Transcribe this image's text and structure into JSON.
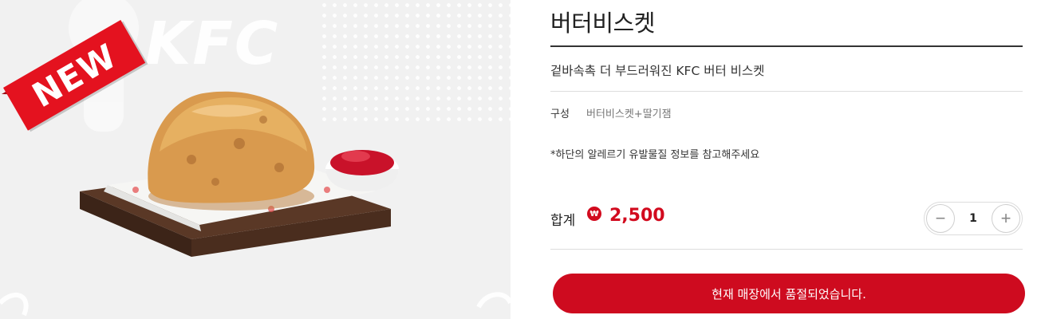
{
  "image": {
    "badge_text": "NEW",
    "watermark_text": "KFC",
    "alt": "butter biscuit with strawberry jam on wooden board"
  },
  "product": {
    "title": "버터비스켓",
    "description": "겉바속촉 더 부드러워진 KFC 버터 비스켓",
    "composition_label": "구성",
    "composition_value": "버터비스켓+딸기잼",
    "allergy_note": "*하단의 알레르기 유발물질 정보를 참고해주세요"
  },
  "order": {
    "total_label": "합계",
    "currency_symbol": "₩",
    "total_price": "2,500",
    "quantity": "1",
    "minus_symbol": "−",
    "plus_symbol": "+",
    "sold_out_label": "현재 매장에서 품절되었습니다."
  },
  "colors": {
    "accent": "#ce0b1f",
    "price": "#d20a1e",
    "panel_bg": "#f1f1f1"
  }
}
